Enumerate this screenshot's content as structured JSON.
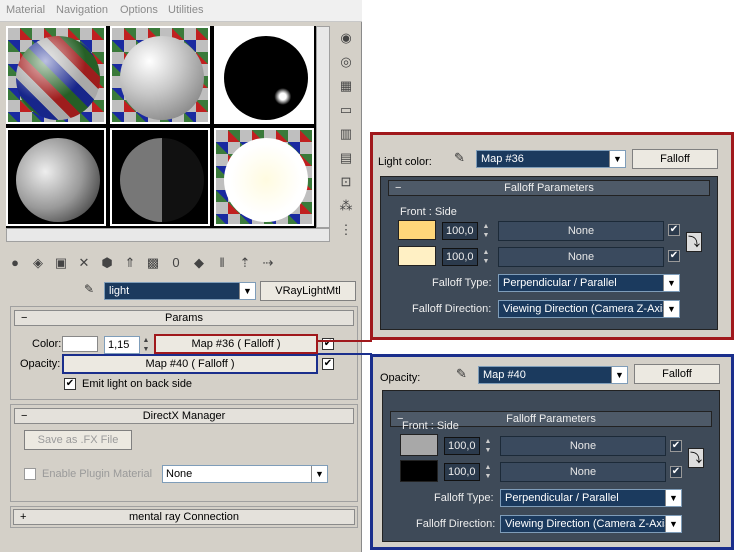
{
  "menu": [
    "Material",
    "Navigation",
    "Options",
    "Utilities"
  ],
  "material_name": "light",
  "material_type": "VRayLightMtl",
  "params": {
    "header": "Params",
    "color_label": "Color:",
    "color_value": "1,15",
    "color_map": "Map #36  ( Falloff )",
    "opacity_label": "Opacity:",
    "opacity_map": "Map #40  ( Falloff )",
    "emit_label": "Emit light on back side"
  },
  "directx": {
    "header": "DirectX Manager",
    "save_button": "Save as .FX File",
    "plugin_label": "Enable Plugin Material",
    "plugin_value": "None"
  },
  "mentalray": {
    "header": "mental ray Connection"
  },
  "light_panel": {
    "label": "Light color:",
    "map": "Map #36",
    "type": "Falloff",
    "rollout": "Falloff Parameters",
    "front_side": "Front : Side",
    "val1": "100,0",
    "val2": "100,0",
    "none1": "None",
    "none2": "None",
    "falloff_type_label": "Falloff Type:",
    "falloff_type": "Perpendicular / Parallel",
    "falloff_dir_label": "Falloff Direction:",
    "falloff_dir": "Viewing Direction (Camera Z-Axis)"
  },
  "opacity_panel": {
    "label": "Opacity:",
    "map": "Map #40",
    "type": "Falloff",
    "rollout": "Falloff Parameters",
    "front_side": "Front : Side",
    "val1": "100,0",
    "val2": "100,0",
    "none1": "None",
    "none2": "None",
    "falloff_type_label": "Falloff Type:",
    "falloff_type": "Perpendicular / Parallel",
    "falloff_dir_label": "Falloff Direction:",
    "falloff_dir": "Viewing Direction (Camera Z-Axis)"
  },
  "colors": {
    "red_box": "#a0181c",
    "blue_box": "#1a2e8c",
    "swatch_light1": "#ffd77a",
    "swatch_light2": "#fff0c4",
    "swatch_op1": "#a8a8a8",
    "swatch_op2": "#000000"
  }
}
